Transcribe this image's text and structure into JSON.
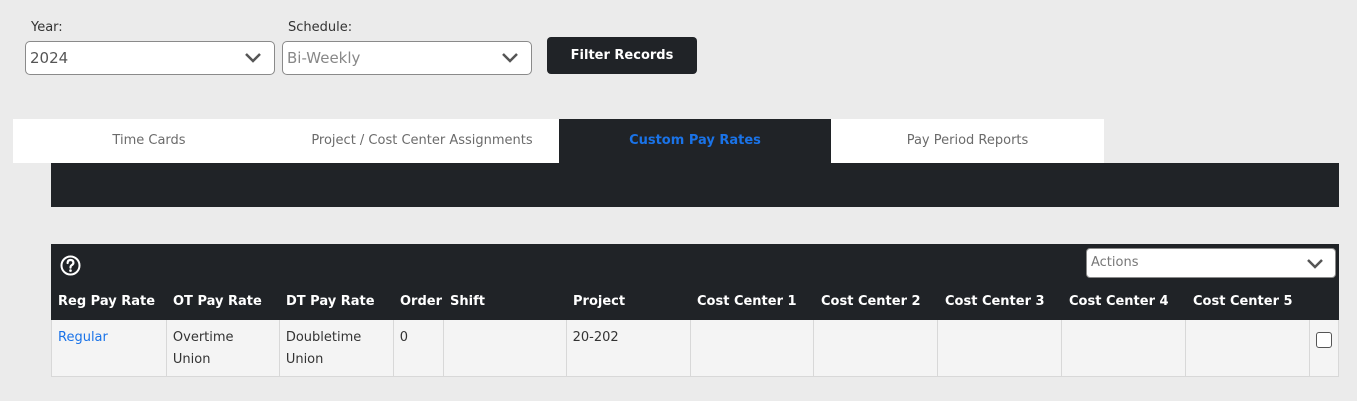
{
  "filters": {
    "year": {
      "label": "Year:",
      "value": "2024"
    },
    "schedule": {
      "label": "Schedule:",
      "value": "Bi-Weekly"
    },
    "filter_button": "Filter Records"
  },
  "tabs": [
    {
      "label": "Time Cards",
      "active": false
    },
    {
      "label": "Project / Cost Center Assignments",
      "active": false
    },
    {
      "label": "Custom Pay Rates",
      "active": true
    },
    {
      "label": "Pay Period Reports",
      "active": false
    }
  ],
  "grid": {
    "actions_placeholder": "Actions",
    "columns": [
      "Reg Pay Rate",
      "OT Pay Rate",
      "DT Pay Rate",
      "Order",
      "Shift",
      "Project",
      "Cost Center 1",
      "Cost Center 2",
      "Cost Center 3",
      "Cost Center 4",
      "Cost Center 5"
    ],
    "rows": [
      {
        "reg_pay_rate": "Regular",
        "ot_pay_rate": "Overtime Union",
        "dt_pay_rate": "Doubletime Union",
        "order": "0",
        "shift": "",
        "project": "20-202",
        "cost_center_1": "",
        "cost_center_2": "",
        "cost_center_3": "",
        "cost_center_4": "",
        "cost_center_5": "",
        "checked": false
      }
    ]
  },
  "colors": {
    "dark": "#202327",
    "accent": "#1a73e8"
  },
  "icons": {
    "help": "help-circle-icon",
    "chevron": "chevron-down-icon"
  }
}
